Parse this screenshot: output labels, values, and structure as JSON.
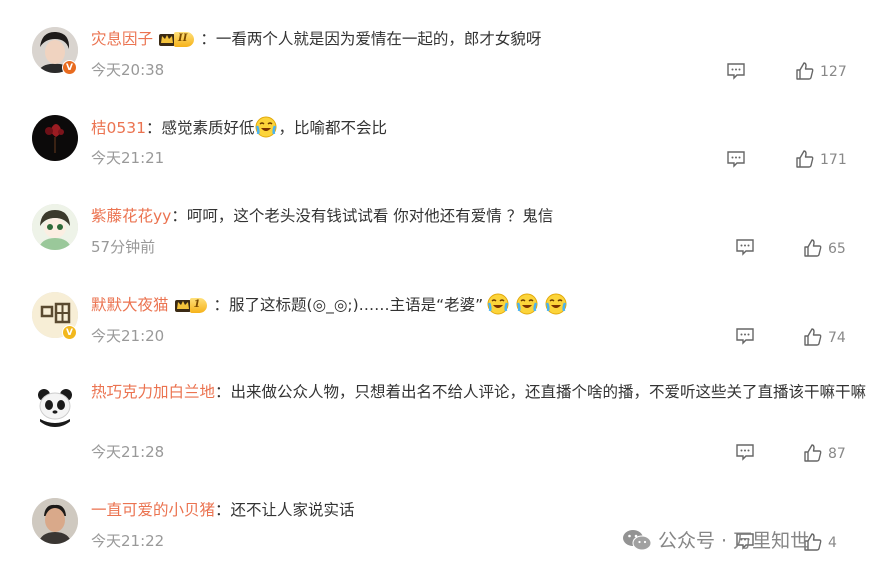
{
  "comments": [
    {
      "username": "灾息因子",
      "level": "II",
      "text": "一看两个人就是因为爱情在一起的，郎才女貌呀",
      "time": "今天20:38",
      "likes": "127",
      "avatar_badge": "V",
      "badge_color": "#e86b1f"
    },
    {
      "username": "桔0531",
      "text_before": "感觉素质好低",
      "text_after": "，比喻都不会比",
      "time": "今天21:21",
      "likes": "171"
    },
    {
      "username": "紫藤花花yy",
      "text": "呵呵，这个老头没有钱试试看 你对他还有爱情 ？鬼信",
      "time": "57分钟前",
      "likes": "65"
    },
    {
      "username": "默默大夜猫",
      "level": "1",
      "text": "服了这标题(◎_◎;)……主语是“老婆”",
      "time": "今天21:20",
      "likes": "74",
      "avatar_badge": "V",
      "badge_color": "#f2b81d"
    },
    {
      "username": "热巧克力加白兰地",
      "text": "出来做公众人物，只想着出名不给人评论，还直播个啥的播，不爱听这些关了直播该干嘛干嘛",
      "time": "今天21:28",
      "likes": "87"
    },
    {
      "username": "一直可爱的小贝猪",
      "text": "还不让人家说实话",
      "time": "今天21:22",
      "likes": "4"
    }
  ],
  "colon": "：",
  "watermark": {
    "text": "公众号 · 万里知世",
    "icon": "wechat-icon"
  },
  "icons": {
    "comment": "comment-icon",
    "like": "thumbs-up-icon",
    "emoji": "laugh-cry-emoji"
  }
}
